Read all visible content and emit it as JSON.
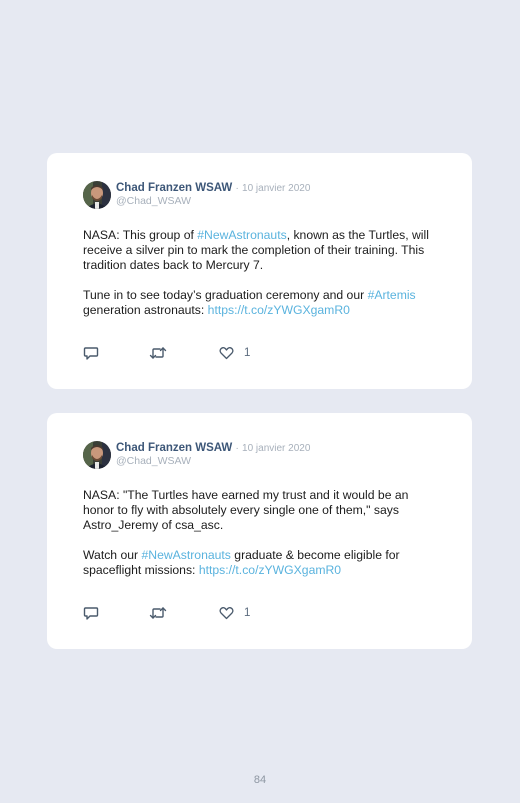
{
  "tweets": [
    {
      "author": "Chad Franzen WSAW",
      "separator": "·",
      "date": "10 janvier 2020",
      "handle": "@Chad_WSAW",
      "likes": "1",
      "paragraph1": {
        "t1": "NASA: This group of ",
        "link1": "#NewAstronauts",
        "t2": ", known as the Turtles, will receive a silver pin to mark the completion of their training. This tradition dates back to Mercury 7."
      },
      "paragraph2": {
        "t1": "Tune in to see today’s graduation ceremony and our ",
        "link1": "#Artemis",
        "t2": " generation astronauts: ",
        "link2": "https://t.co/zYWGXgamR0"
      }
    },
    {
      "author": "Chad Franzen WSAW",
      "separator": "·",
      "date": "10 janvier 2020",
      "handle": "@Chad_WSAW",
      "likes": "1",
      "paragraph1": {
        "t1": "NASA: \"The Turtles have earned my trust and it would be an honor to fly with absolutely every single one of them,\" says Astro_Jeremy of csa_asc."
      },
      "paragraph2": {
        "t1": "Watch our ",
        "link1": "#NewAstronauts",
        "t2": " graduate & become eligible for spaceflight missions: ",
        "link2": "https://t.co/zYWGXgamR0"
      }
    }
  ],
  "page_number": "84",
  "colors": {
    "background": "#e6e9f2",
    "card": "#ffffff",
    "author_name": "#3d5778",
    "muted": "#a7b0bb",
    "link": "#5ab3de",
    "body_text": "#1c1c1c",
    "icon": "#4a5a6c"
  }
}
